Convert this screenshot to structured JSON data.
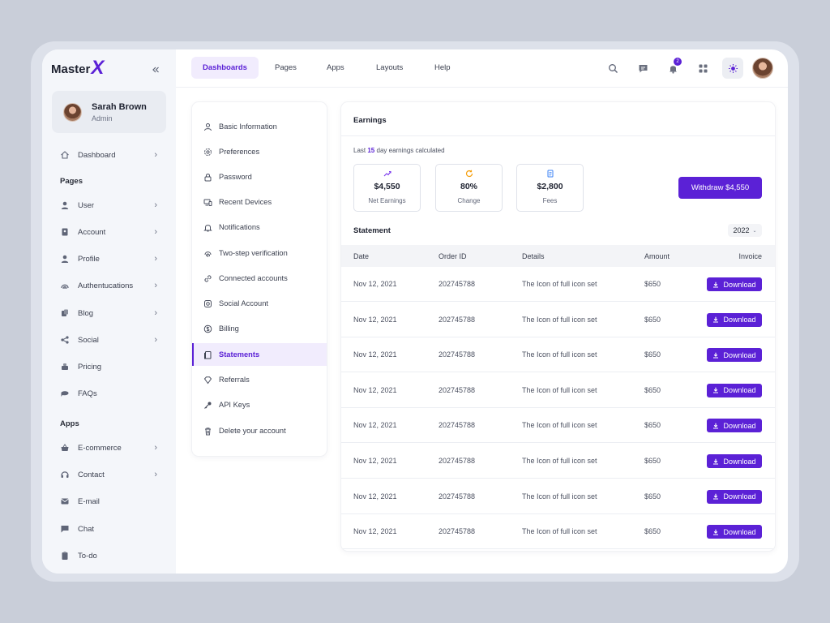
{
  "brand": {
    "name": "Master",
    "mark": "X"
  },
  "user": {
    "name": "Sarah Brown",
    "role": "Admin"
  },
  "sidebar": {
    "dashboard": "Dashboard",
    "pages_section": "Pages",
    "pages": [
      "User",
      "Account",
      "Profile",
      "Authentucations",
      "Blog",
      "Social",
      "Pricing",
      "FAQs"
    ],
    "apps_section": "Apps",
    "apps": [
      "E-commerce",
      "Contact",
      "E-mail",
      "Chat",
      "To-do"
    ]
  },
  "topnav": {
    "tabs": [
      "Dashboards",
      "Pages",
      "Apps",
      "Layouts",
      "Help"
    ],
    "notification_count": "2"
  },
  "settings_menu": {
    "items": [
      "Basic Information",
      "Preferences",
      "Password",
      "Recent Devices",
      "Notifications",
      "Two-step verification",
      "Connected accounts",
      "Social Account",
      "Billing",
      "Statements",
      "Referrals",
      "API Keys",
      "Delete your account"
    ],
    "active": "Statements"
  },
  "earnings": {
    "title": "Earnings",
    "subtitle_prefix": "Last",
    "subtitle_days": "15",
    "subtitle_suffix": "day earnings calculated",
    "stats": [
      {
        "value": "$4,550",
        "label": "Net Earnings",
        "icon": "trend-up-icon",
        "color": "#7c3aed"
      },
      {
        "value": "80%",
        "label": "Change",
        "icon": "refresh-icon",
        "color": "#f59e0b"
      },
      {
        "value": "$2,800",
        "label": "Fees",
        "icon": "receipt-icon",
        "color": "#3b82f6"
      }
    ],
    "withdraw_label": "Withdraw $4,550"
  },
  "statement": {
    "title": "Statement",
    "year": "2022",
    "columns": [
      "Date",
      "Order ID",
      "Details",
      "Amount",
      "Invoice"
    ],
    "rows": [
      {
        "date": "Nov 12, 2021",
        "order_id": "202745788",
        "details": "The Icon of full icon set",
        "amount": "$650"
      },
      {
        "date": "Nov 12, 2021",
        "order_id": "202745788",
        "details": "The Icon of full icon set",
        "amount": "$650"
      },
      {
        "date": "Nov 12, 2021",
        "order_id": "202745788",
        "details": "The Icon of full icon set",
        "amount": "$650"
      },
      {
        "date": "Nov 12, 2021",
        "order_id": "202745788",
        "details": "The Icon of full icon set",
        "amount": "$650"
      },
      {
        "date": "Nov 12, 2021",
        "order_id": "202745788",
        "details": "The Icon of full icon set",
        "amount": "$650"
      },
      {
        "date": "Nov 12, 2021",
        "order_id": "202745788",
        "details": "The Icon of full icon set",
        "amount": "$650"
      },
      {
        "date": "Nov 12, 2021",
        "order_id": "202745788",
        "details": "The Icon of full icon set",
        "amount": "$650"
      },
      {
        "date": "Nov 12, 2021",
        "order_id": "202745788",
        "details": "The Icon of full icon set",
        "amount": "$650"
      }
    ],
    "download_label": "Download"
  },
  "colors": {
    "accent": "#5b21d6",
    "accent_soft": "#f1ecfd"
  }
}
